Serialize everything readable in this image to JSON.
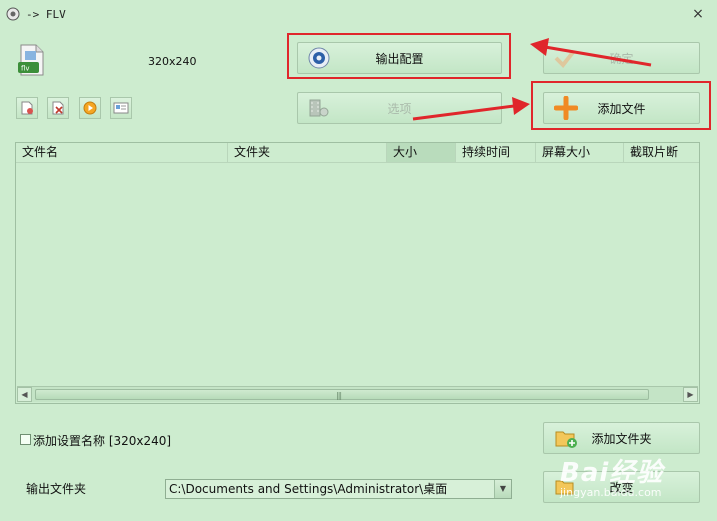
{
  "window": {
    "title": "-> FLV",
    "close_glyph": "×"
  },
  "preset": {
    "resolution": "320x240",
    "icon_label": "flv"
  },
  "buttons": {
    "output_config": "输出配置",
    "ok": "确定",
    "options": "选项",
    "add_file": "添加文件",
    "add_folder": "添加文件夹",
    "change": "改变"
  },
  "toolbar": {
    "icons": [
      "remove-file-icon",
      "clear-list-icon",
      "play-icon",
      "info-icon"
    ]
  },
  "table": {
    "columns": [
      "文件名",
      "文件夹",
      "大小",
      "持续时间",
      "屏幕大小",
      "截取片断"
    ],
    "rows": []
  },
  "options": {
    "add_setting_name_label": "添加设置名称",
    "add_setting_name_value": "[320x240]",
    "add_setting_name_checked": false
  },
  "output": {
    "folder_label": "输出文件夹",
    "folder_path": "C:\\Documents and Settings\\Administrator\\桌面"
  },
  "watermark": {
    "brand": "Bai经验",
    "url": "jingyan.baidu.com"
  },
  "colors": {
    "background": "#cdeccf",
    "annotation_red": "#e0262b",
    "accent_orange": "#f08a24"
  }
}
